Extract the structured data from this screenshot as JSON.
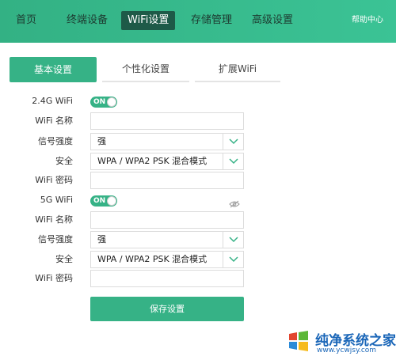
{
  "nav": {
    "items": [
      {
        "label": "首页",
        "active": false
      },
      {
        "label": "终端设备",
        "active": false
      },
      {
        "label": "WiFi设置",
        "active": true
      },
      {
        "label": "存储管理",
        "active": false
      },
      {
        "label": "高级设置",
        "active": false
      }
    ],
    "help": "帮助中心"
  },
  "tabs": [
    {
      "label": "基本设置",
      "active": true
    },
    {
      "label": "个性化设置",
      "active": false
    },
    {
      "label": "扩展WiFi",
      "active": false
    }
  ],
  "wifi24": {
    "label": "2.4G WiFi",
    "toggle_text": "ON",
    "name_label": "WiFi 名称",
    "name_value": "",
    "signal_label": "信号强度",
    "signal_value": "强",
    "security_label": "安全",
    "security_value": "WPA / WPA2 PSK 混合模式",
    "password_label": "WiFi 密码",
    "password_value": ""
  },
  "wifi5": {
    "label": "5G WiFi",
    "toggle_text": "ON",
    "name_label": "WiFi 名称",
    "name_value": "",
    "signal_label": "信号强度",
    "signal_value": "强",
    "security_label": "安全",
    "security_value": "WPA / WPA2 PSK 混合模式",
    "password_label": "WiFi 密码",
    "password_value": ""
  },
  "save_label": "保存设置",
  "watermark": {
    "title": "纯净系统之家",
    "url": "www.ycwjsy.com"
  },
  "colors": {
    "accent": "#36b286",
    "nav_active_bg": "#1e5a48",
    "watermark": "#1a66b8"
  },
  "icons": {
    "select_arrow": "chevron-down-icon",
    "password_visibility": "eye-slash-icon"
  }
}
